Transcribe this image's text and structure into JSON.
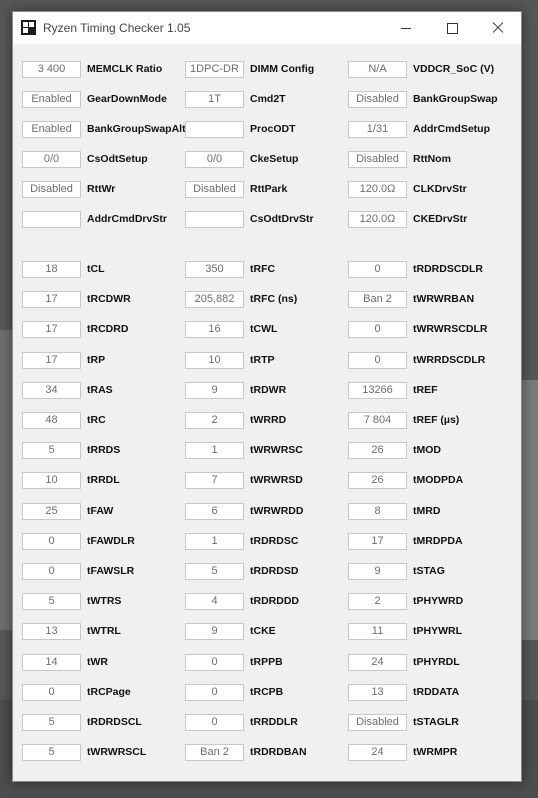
{
  "window": {
    "title": "Ryzen Timing Checker 1.05",
    "icon": "app-grid-icon",
    "controls": [
      "minimize-icon",
      "maximize-icon",
      "close-icon"
    ]
  },
  "config": [
    [
      {
        "value": "3 400",
        "label": "MEMCLK Ratio"
      },
      {
        "value": "1DPC-DR",
        "label": "DIMM Config"
      },
      {
        "value": "N/A",
        "label": "VDDCR_SoC (V)"
      }
    ],
    [
      {
        "value": "Enabled",
        "label": "GearDownMode"
      },
      {
        "value": "1T",
        "label": "Cmd2T"
      },
      {
        "value": "Disabled",
        "label": "BankGroupSwap"
      }
    ],
    [
      {
        "value": "Enabled",
        "label": "BankGroupSwapAlt"
      },
      {
        "value": "",
        "label": "ProcODT"
      },
      {
        "value": "1/31",
        "label": "AddrCmdSetup"
      }
    ],
    [
      {
        "value": "0/0",
        "label": "CsOdtSetup"
      },
      {
        "value": "0/0",
        "label": "CkeSetup"
      },
      {
        "value": "Disabled",
        "label": "RttNom"
      }
    ],
    [
      {
        "value": "Disabled",
        "label": "RttWr"
      },
      {
        "value": "Disabled",
        "label": "RttPark"
      },
      {
        "value": "120.0Ω",
        "label": "CLKDrvStr"
      }
    ],
    [
      {
        "value": "",
        "label": "AddrCmdDrvStr"
      },
      {
        "value": "",
        "label": "CsOdtDrvStr"
      },
      {
        "value": "120.0Ω",
        "label": "CKEDrvStr"
      }
    ]
  ],
  "timings": [
    [
      {
        "value": "18",
        "label": "tCL"
      },
      {
        "value": "350",
        "label": "tRFC"
      },
      {
        "value": "0",
        "label": "tRDRDSCDLR"
      }
    ],
    [
      {
        "value": "17",
        "label": "tRCDWR"
      },
      {
        "value": "205,882",
        "label": "tRFC (ns)"
      },
      {
        "value": "Ban 2",
        "label": "tWRWRBAN"
      }
    ],
    [
      {
        "value": "17",
        "label": "tRCDRD"
      },
      {
        "value": "16",
        "label": "tCWL"
      },
      {
        "value": "0",
        "label": "tWRWRSCDLR"
      }
    ],
    [
      {
        "value": "17",
        "label": "tRP"
      },
      {
        "value": "10",
        "label": "tRTP"
      },
      {
        "value": "0",
        "label": "tWRRDSCDLR"
      }
    ],
    [
      {
        "value": "34",
        "label": "tRAS"
      },
      {
        "value": "9",
        "label": "tRDWR"
      },
      {
        "value": "13266",
        "label": "tREF"
      }
    ],
    [
      {
        "value": "48",
        "label": "tRC"
      },
      {
        "value": "2",
        "label": "tWRRD"
      },
      {
        "value": "7 804",
        "label": "tREF (µs)"
      }
    ],
    [
      {
        "value": "5",
        "label": "tRRDS"
      },
      {
        "value": "1",
        "label": "tWRWRSC"
      },
      {
        "value": "26",
        "label": "tMOD"
      }
    ],
    [
      {
        "value": "10",
        "label": "tRRDL"
      },
      {
        "value": "7",
        "label": "tWRWRSD"
      },
      {
        "value": "26",
        "label": "tMODPDA"
      }
    ],
    [
      {
        "value": "25",
        "label": "tFAW"
      },
      {
        "value": "6",
        "label": "tWRWRDD"
      },
      {
        "value": "8",
        "label": "tMRD"
      }
    ],
    [
      {
        "value": "0",
        "label": "tFAWDLR"
      },
      {
        "value": "1",
        "label": "tRDRDSC"
      },
      {
        "value": "17",
        "label": "tMRDPDA"
      }
    ],
    [
      {
        "value": "0",
        "label": "tFAWSLR"
      },
      {
        "value": "5",
        "label": "tRDRDSD"
      },
      {
        "value": "9",
        "label": "tSTAG"
      }
    ],
    [
      {
        "value": "5",
        "label": "tWTRS"
      },
      {
        "value": "4",
        "label": "tRDRDDD"
      },
      {
        "value": "2",
        "label": "tPHYWRD"
      }
    ],
    [
      {
        "value": "13",
        "label": "tWTRL"
      },
      {
        "value": "9",
        "label": "tCKE"
      },
      {
        "value": "11",
        "label": "tPHYWRL"
      }
    ],
    [
      {
        "value": "14",
        "label": "tWR"
      },
      {
        "value": "0",
        "label": "tRPPB"
      },
      {
        "value": "24",
        "label": "tPHYRDL"
      }
    ],
    [
      {
        "value": "0",
        "label": "tRCPage"
      },
      {
        "value": "0",
        "label": "tRCPB"
      },
      {
        "value": "13",
        "label": "tRDDATA"
      }
    ],
    [
      {
        "value": "5",
        "label": "tRDRDSCL"
      },
      {
        "value": "0",
        "label": "tRRDDLR"
      },
      {
        "value": "Disabled",
        "label": "tSTAGLR"
      }
    ],
    [
      {
        "value": "5",
        "label": "tWRWRSCL"
      },
      {
        "value": "Ban 2",
        "label": "tRDRDBAN"
      },
      {
        "value": "24",
        "label": "tWRMPR"
      }
    ]
  ]
}
